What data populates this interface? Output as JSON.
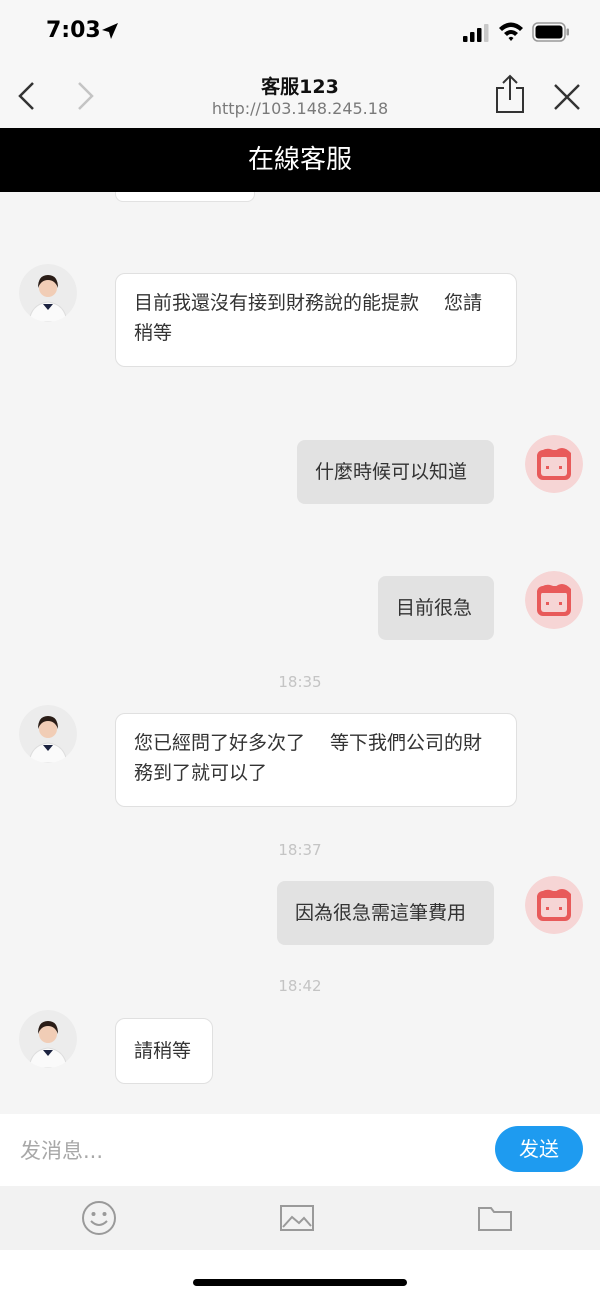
{
  "status_bar": {
    "time": "7:03"
  },
  "browser": {
    "title": "客服123",
    "url": "http://103.148.245.18"
  },
  "banner": {
    "title": "在線客服"
  },
  "messages": [
    {
      "side": "in",
      "text": "目前我還沒有接到財務說的能提款　 您請稍等"
    },
    {
      "side": "out",
      "text": "什麼時候可以知道"
    },
    {
      "side": "out",
      "text": "目前很急"
    },
    {
      "side": "time",
      "text": "18:35"
    },
    {
      "side": "in",
      "text": "您已經問了好多次了　 等下我們公司的財務到了就可以了"
    },
    {
      "side": "time",
      "text": "18:37"
    },
    {
      "side": "out",
      "text": "因為很急需這筆費用"
    },
    {
      "side": "time",
      "text": "18:42"
    },
    {
      "side": "in",
      "text": "請稍等"
    }
  ],
  "composer": {
    "placeholder": "发消息...",
    "send_label": "发送"
  },
  "toolbar": {
    "icons": [
      "emoji-icon",
      "image-icon",
      "folder-icon"
    ]
  },
  "colors": {
    "send": "#1e9bf0",
    "banner": "#000000",
    "user_avatar": "#e85a5a"
  }
}
